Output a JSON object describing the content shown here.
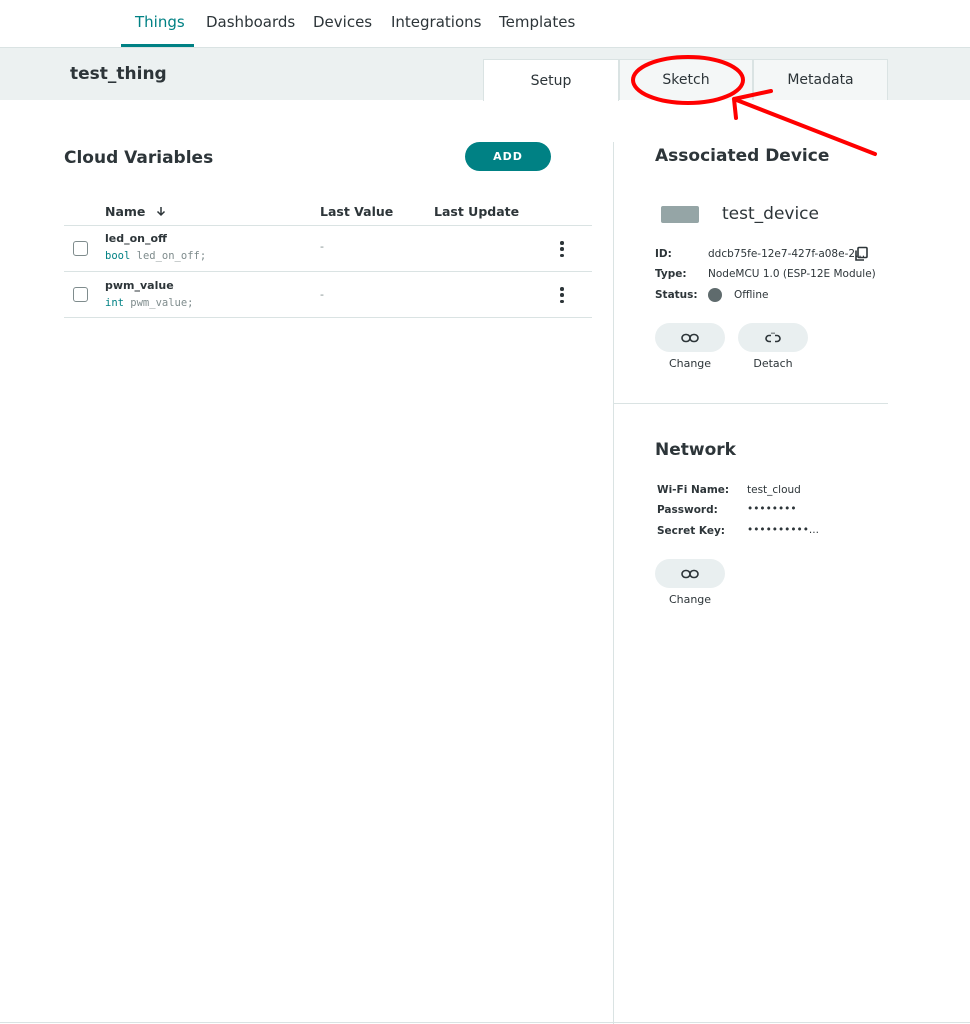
{
  "nav": {
    "items": [
      {
        "label": "Things",
        "active": true
      },
      {
        "label": "Dashboards",
        "active": false
      },
      {
        "label": "Devices",
        "active": false
      },
      {
        "label": "Integrations",
        "active": false
      },
      {
        "label": "Templates",
        "active": false
      }
    ],
    "accent_color": "#008184"
  },
  "thing": {
    "title": "test_thing",
    "tabs": [
      {
        "label": "Setup",
        "active": true
      },
      {
        "label": "Sketch",
        "active": false
      },
      {
        "label": "Metadata",
        "active": false
      }
    ]
  },
  "cloud_variables": {
    "title": "Cloud Variables",
    "add_label": "ADD",
    "columns": {
      "name": "Name",
      "last_value": "Last Value",
      "last_update": "Last Update"
    },
    "sort_icon": "arrow-down-icon",
    "rows": [
      {
        "name": "led_on_off",
        "type": "bool",
        "decl": " led_on_off;",
        "last_value": "-",
        "last_update": ""
      },
      {
        "name": "pwm_value",
        "type": "int",
        "decl": " pwm_value;",
        "last_value": "-",
        "last_update": ""
      }
    ]
  },
  "device": {
    "title": "Associated Device",
    "name": "test_device",
    "id_label": "ID:",
    "id_value": "ddcb75fe-12e7-427f-a08e-2...",
    "type_label": "Type:",
    "type_value": "NodeMCU 1.0 (ESP-12E Module)",
    "status_label": "Status:",
    "status_value": "Offline",
    "change_label": "Change",
    "detach_label": "Detach"
  },
  "network": {
    "title": "Network",
    "wifi_label": "Wi-Fi Name:",
    "wifi_value": "test_cloud",
    "password_label": "Password:",
    "password_value": "••••••••",
    "secret_label": "Secret Key:",
    "secret_value": "••••••••••...",
    "change_label": "Change"
  },
  "annotation": {
    "color": "#ff0000"
  }
}
